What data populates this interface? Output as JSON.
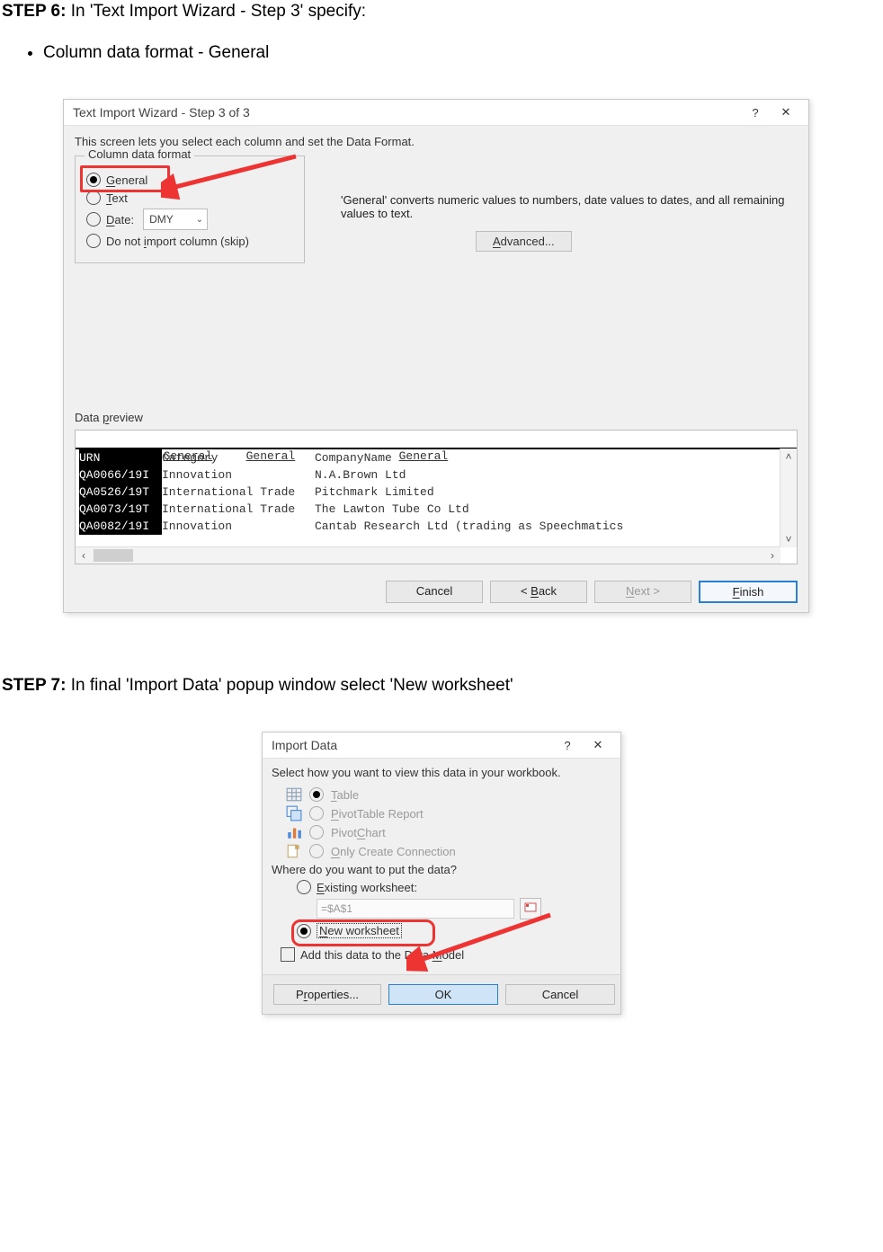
{
  "step6": {
    "heading_bold": "STEP 6:",
    "heading_rest": "  In 'Text Import Wizard - Step 3' specify:",
    "bullet": "Column data format - General"
  },
  "wizard": {
    "title": "Text Import Wizard - Step 3 of 3",
    "help": "?",
    "close": "✕",
    "intro": "This screen lets you select each column and set the Data Format.",
    "fieldset_label": "Column data format",
    "radios": {
      "general": "General",
      "text": "Text",
      "date": "Date:",
      "skip": "Do not import column (skip)"
    },
    "date_value": "DMY",
    "explain": "'General' converts numeric values to numbers, date values to dates, and all remaining values to text.",
    "advanced": "Advanced...",
    "preview_label": "Data preview",
    "columns": [
      "General",
      "General",
      "General"
    ],
    "rows": [
      [
        "URN",
        "Category",
        "CompanyName"
      ],
      [
        "QA0066/19I",
        "Innovation",
        "N.A.Brown Ltd"
      ],
      [
        "QA0526/19T",
        "International Trade",
        "Pitchmark Limited"
      ],
      [
        "QA0073/19T",
        "International Trade",
        "The Lawton Tube Co Ltd"
      ],
      [
        "QA0082/19I",
        "Innovation",
        "Cantab Research Ltd (trading as Speechmatics"
      ]
    ],
    "buttons": {
      "cancel": "Cancel",
      "back": "< Back",
      "next": "Next >",
      "finish": "Finish"
    }
  },
  "step7": {
    "heading_bold": "STEP 7:",
    "heading_rest": " In final 'Import Data' popup window select 'New worksheet'"
  },
  "import": {
    "title": "Import Data",
    "help": "?",
    "close": "✕",
    "intro": "Select how you want to view this data in your workbook.",
    "views": {
      "table": "Table",
      "pivottable": "PivotTable Report",
      "pivotchart": "PivotChart",
      "connection": "Only Create Connection"
    },
    "put_label": "Where do you want to put the data?",
    "existing": "Existing worksheet:",
    "ref": "=$A$1",
    "new": "New worksheet",
    "datamodel": "Add this data to the Data Model",
    "buttons": {
      "properties": "Properties...",
      "ok": "OK",
      "cancel": "Cancel"
    }
  }
}
